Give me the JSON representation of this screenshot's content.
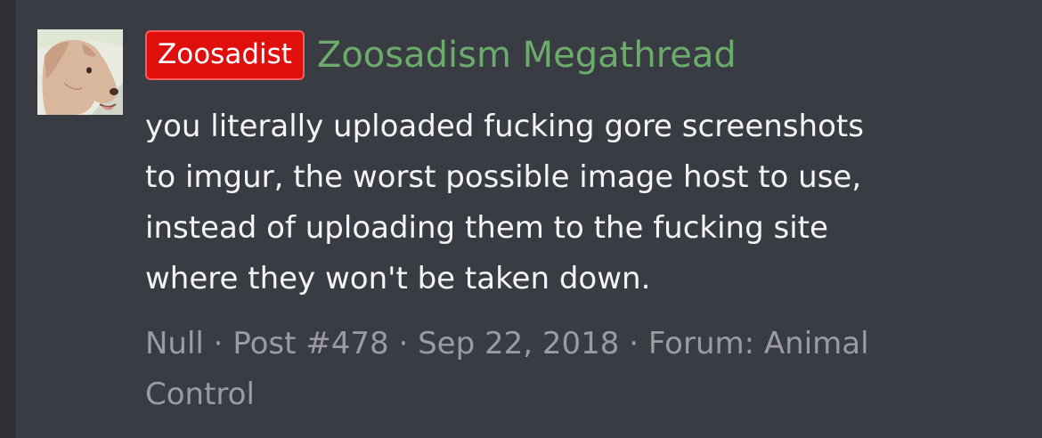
{
  "post": {
    "tag": "Zoosadist",
    "thread_title": "Zoosadism Megathread",
    "body_lines": [
      "you literally uploaded fucking gore screenshots",
      "to imgur, the worst possible image host to use,",
      "instead of uploading them to the fucking site",
      "where they won't be taken down."
    ],
    "meta": {
      "author": "Null",
      "separator": " · ",
      "post_number": "Post #478",
      "date": "Sep 22, 2018",
      "forum_line1": "Forum: Animal",
      "forum_line2": "Control"
    }
  },
  "colors": {
    "background": "#2f3136",
    "panel": "#393c43",
    "tag_bg": "#e10e0e",
    "title_green": "#6cab6c",
    "body_text": "#f3f4f6",
    "meta_text": "#9a9ca2"
  },
  "avatar": {
    "icon": "dog-avatar"
  }
}
